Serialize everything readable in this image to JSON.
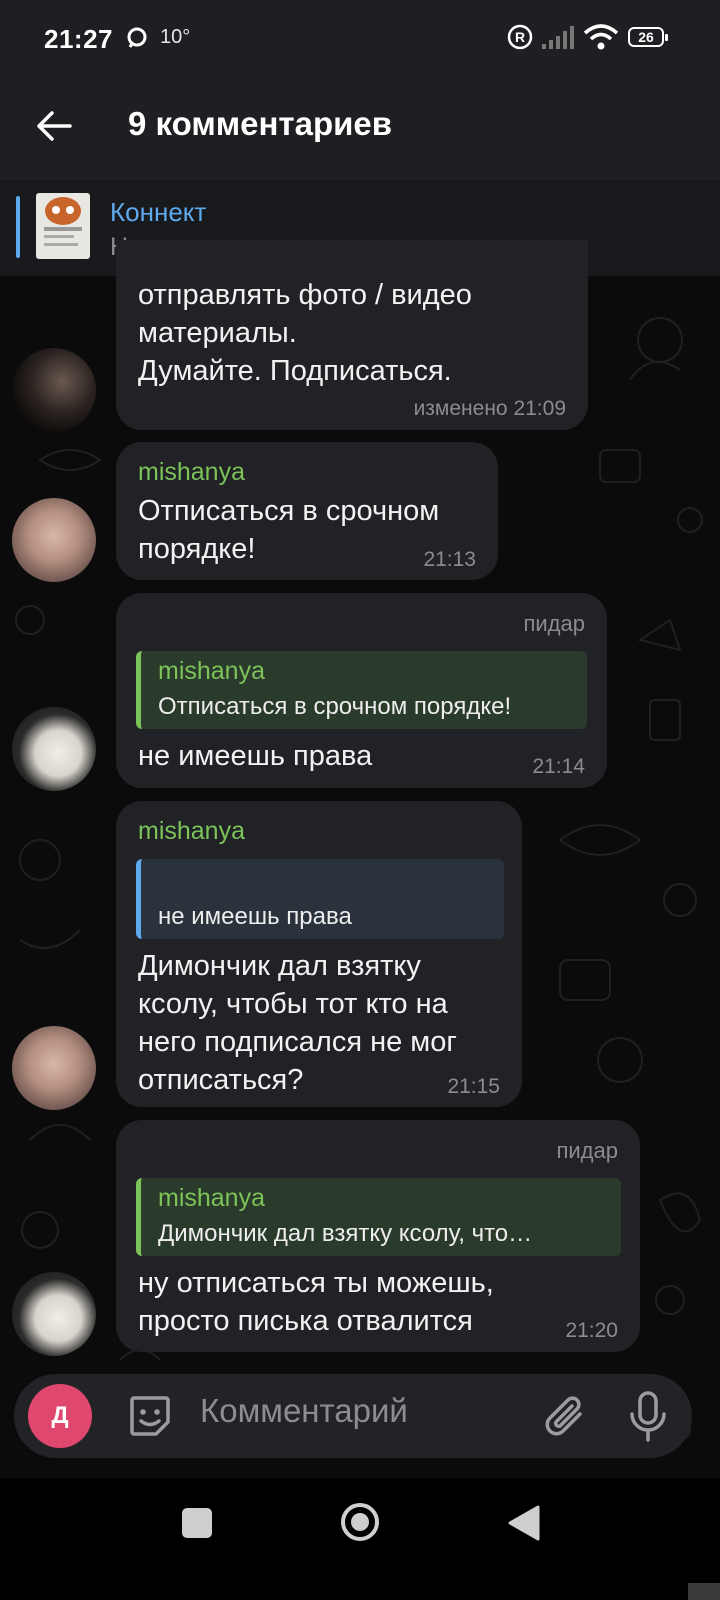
{
  "status_bar": {
    "time": "21:27",
    "temperature": "10°",
    "battery": "26"
  },
  "header": {
    "title": "9 комментариев",
    "back_icon": "arrow-left-icon"
  },
  "pinned": {
    "name": "Коннект",
    "text": "Не понял"
  },
  "messages": [
    {
      "text": "отправлять фото / видео\nматериалы.\nДумайте. Подписаться.",
      "time": "изменено 21:09"
    },
    {
      "name": "mishanya",
      "text": "Отписаться в срочном\nпорядке!",
      "time": "21:13"
    },
    {
      "author": "пидар",
      "quote": {
        "name": "mishanya",
        "text": "Отписаться в срочном порядке!"
      },
      "text": "не имеешь права",
      "time": "21:14"
    },
    {
      "name": "mishanya",
      "quote": {
        "text": "не имеешь права"
      },
      "text": "Димончик дал взятку\nксолу, чтобы тот кто на\nнего подписался не мог\nотписаться?",
      "time": "21:15"
    },
    {
      "author": "пидар",
      "quote": {
        "name": "mishanya",
        "text": "Димончик дал взятку ксолу, что…"
      },
      "text": "ну отписаться ты можешь,\nпросто писька отвалится",
      "time": "21:20"
    }
  ],
  "input": {
    "avatar_letter": "Д",
    "placeholder": "Комментарий"
  },
  "colors": {
    "accent_blue": "#5ea9ee",
    "name_green": "#7cc35a",
    "bubble": "#212226",
    "avatar_pink": "#e0476e"
  }
}
